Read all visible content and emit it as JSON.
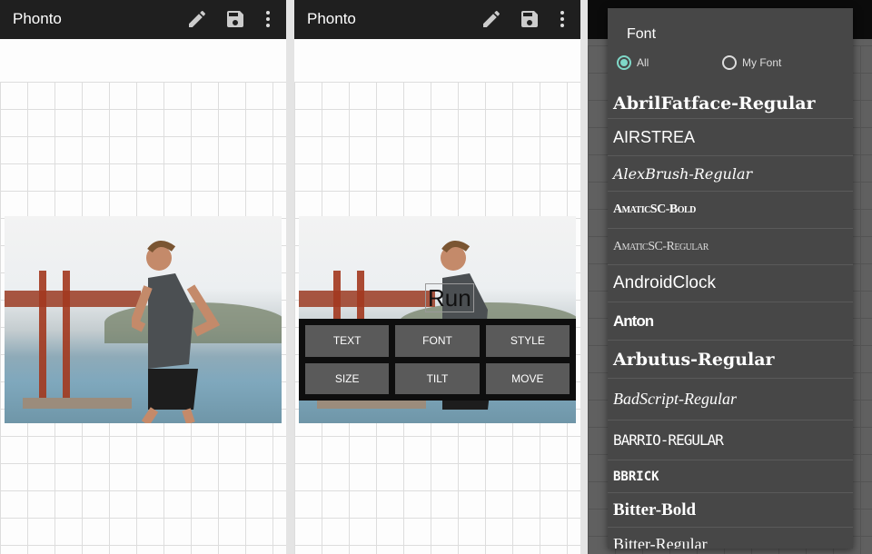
{
  "app_title": "Phonto",
  "icons": [
    "pencil-icon",
    "save-icon",
    "more-vert-icon"
  ],
  "canvas_text": "Run",
  "toolbox": [
    "TEXT",
    "FONT",
    "STYLE",
    "SIZE",
    "TILT",
    "MOVE"
  ],
  "font_dialog": {
    "title": "Font",
    "radio_all": "All",
    "radio_my_font": "My Font",
    "selected": "All",
    "fonts": [
      "AbrilFatface-Regular",
      "AIRSTREA",
      "AlexBrush-Regular",
      "AmaticSC-Bold",
      "AmaticSC-Regular",
      "AndroidClock",
      "Anton",
      "Arbutus-Regular",
      "BadScript-Regular",
      "BARRIO-REGULAR",
      "BBRICK",
      "Bitter-Bold",
      "Bitter-Regular"
    ]
  },
  "colors": {
    "accent": "#7fd8c8",
    "bar": "#1f1f1f",
    "dialog": "#474747"
  }
}
